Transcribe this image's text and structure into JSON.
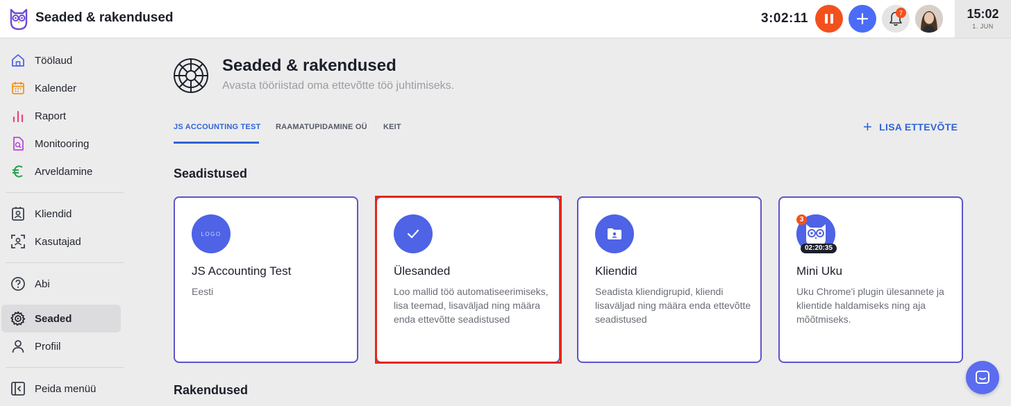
{
  "header": {
    "app_title": "Seaded & rakendused",
    "timer": "3:02:11",
    "notifications_count": "7",
    "clock_time": "15:02",
    "clock_date": "1. JUN"
  },
  "sidebar": {
    "items": [
      {
        "label": "Töölaud",
        "icon": "home-icon"
      },
      {
        "label": "Kalender",
        "icon": "calendar-icon"
      },
      {
        "label": "Raport",
        "icon": "chart-icon"
      },
      {
        "label": "Monitooring",
        "icon": "monitor-doc-icon"
      },
      {
        "label": "Arveldamine",
        "icon": "euro-icon"
      },
      {
        "label": "Kliendid",
        "icon": "contacts-icon"
      },
      {
        "label": "Kasutajad",
        "icon": "user-scan-icon"
      },
      {
        "label": "Abi",
        "icon": "help-icon"
      },
      {
        "label": "Seaded",
        "icon": "gear-icon"
      },
      {
        "label": "Profiil",
        "icon": "person-icon"
      },
      {
        "label": "Peida menüü",
        "icon": "collapse-icon"
      }
    ],
    "active": "Seaded"
  },
  "main": {
    "title": "Seaded & rakendused",
    "subtitle": "Avasta tööriistad oma ettevõtte töö juhtimiseks.",
    "tabs": [
      "JS ACCOUNTING TEST",
      "RAAMATUPIDAMINE OÜ",
      "KEIT"
    ],
    "active_tab": "JS ACCOUNTING TEST",
    "add_company_label": "LISA ETTEVÕTE",
    "section_settings": "Seadistused",
    "section_apps": "Rakendused",
    "cards": [
      {
        "title": "JS Accounting Test",
        "desc": "Eesti",
        "icon_text": "LOGO"
      },
      {
        "title": "Ülesanded",
        "desc": "Loo mallid töö automatiseerimiseks, lisa teemad, lisaväljad ning määra enda ettevõtte seadistused"
      },
      {
        "title": "Kliendid",
        "desc": "Seadista kliendigrupid, kliendi lisaväljad ning määra enda ettevõtte seadistused"
      },
      {
        "title": "Mini Uku",
        "desc": "Uku Chrome'i plugin ülesannete ja klientide haldamiseks ning aja mõõtmiseks.",
        "badge": "3",
        "timer": "02:20:35"
      }
    ]
  },
  "colors": {
    "accent": "#2f63d6",
    "card_border": "#5b54c9",
    "icon_bg": "#4e63e6",
    "pause": "#f2511e",
    "highlight": "#e3261b"
  }
}
